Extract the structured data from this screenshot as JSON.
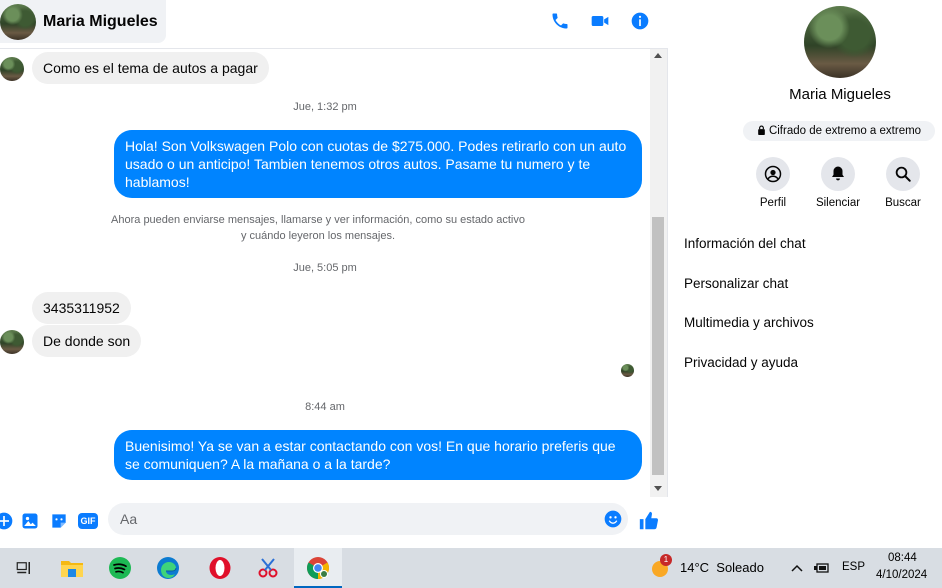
{
  "contact": {
    "name": "Maria Migueles"
  },
  "header_icons": [
    "phone-icon",
    "video-camera-icon",
    "info-icon"
  ],
  "messages": {
    "first_incoming": "Como es el tema de autos a pagar",
    "ts1": "Jue, 1:32 pm",
    "outgoing1": "Hola! Son Volkswagen Polo con cuotas de $275.000. Podes retirarlo con un auto usado o un anticipo! Tambien tenemos otros autos. Pasame tu numero y te hablamos!",
    "system_note_line1": "Ahora pueden enviarse mensajes, llamarse y ver información, como su estado activo",
    "system_note_line2": "y cuándo leyeron los mensajes.",
    "ts2": "Jue, 5:05 pm",
    "incoming_phone": "3435311952",
    "incoming_where": "De donde son",
    "ts3": "8:44 am",
    "outgoing2": "Buenisimo! Ya se van a estar contactando con vos! En que horario preferis que se comuniquen? A la mañana o a la tarde?"
  },
  "composer": {
    "placeholder": "Aa",
    "icons": [
      "plus-icon",
      "image-icon",
      "sticker-icon",
      "gif-icon",
      "emoji-icon",
      "like-icon"
    ],
    "gif_label": "GIF"
  },
  "info_panel": {
    "name": "Maria Migueles",
    "encrypted": "Cifrado de extremo a extremo",
    "actions": [
      {
        "label": "Perfil",
        "icon": "profile-icon"
      },
      {
        "label": "Silenciar",
        "icon": "bell-icon"
      },
      {
        "label": "Buscar",
        "icon": "search-icon"
      }
    ],
    "menu": [
      "Información del chat",
      "Personalizar chat",
      "Multimedia y archivos",
      "Privacidad y ayuda"
    ]
  },
  "taskbar": {
    "apps": [
      "task-view-icon",
      "file-explorer-icon",
      "spotify-icon",
      "edge-icon",
      "opera-icon",
      "snipping-tool-icon",
      "chrome-icon"
    ],
    "weather_badge": "1",
    "weather": "14°C  Soleado",
    "language": "ESP",
    "time": "08:44",
    "date": "4/10/2024"
  },
  "colors": {
    "accent": "#0084ff",
    "icon_blue": "#0a7cff",
    "incoming_bubble": "#f0f0f0"
  }
}
